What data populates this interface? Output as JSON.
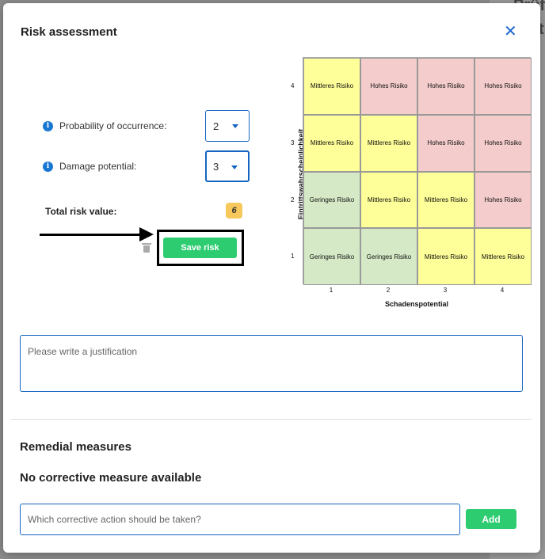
{
  "background": {
    "text_top": "Prüfu",
    "text_second": "t"
  },
  "modal": {
    "title": "Risk assessment",
    "close_label": "✕"
  },
  "form": {
    "probability_label": "Probability of occurrence:",
    "probability_value": "2",
    "damage_label": "Damage potential:",
    "damage_value": "3",
    "total_label": "Total risk value:",
    "total_value": "6",
    "save_label": "Save risk",
    "info_glyph": "i"
  },
  "matrix": {
    "ylabel": "Eintrittswahrscheinlichkeit",
    "xlabel": "Schadenspotential",
    "y_ticks": [
      "4",
      "3",
      "2",
      "1"
    ],
    "x_ticks": [
      "1",
      "2",
      "3",
      "4"
    ],
    "rows": [
      [
        {
          "text": "Mittleres Risiko",
          "level": "mid"
        },
        {
          "text": "Hohes Risiko",
          "level": "high"
        },
        {
          "text": "Hohes Risiko",
          "level": "high"
        },
        {
          "text": "Hohes Risiko",
          "level": "high"
        }
      ],
      [
        {
          "text": "Mittleres Risiko",
          "level": "mid"
        },
        {
          "text": "Mittleres Risiko",
          "level": "mid"
        },
        {
          "text": "Hohes Risiko",
          "level": "high"
        },
        {
          "text": "Hohes Risiko",
          "level": "high"
        }
      ],
      [
        {
          "text": "Geringes Risiko",
          "level": "low"
        },
        {
          "text": "Mittleres Risiko",
          "level": "mid"
        },
        {
          "text": "Mittleres Risiko",
          "level": "mid"
        },
        {
          "text": "Hohes Risiko",
          "level": "high"
        }
      ],
      [
        {
          "text": "Geringes Risiko",
          "level": "low"
        },
        {
          "text": "Geringes Risiko",
          "level": "low"
        },
        {
          "text": "Mittleres Risiko",
          "level": "mid"
        },
        {
          "text": "Mittleres Risiko",
          "level": "mid"
        }
      ]
    ],
    "colors": {
      "low": "#d6e9c6",
      "mid": "#ffff99",
      "high": "#f4cccc"
    }
  },
  "justification": {
    "placeholder": "Please write a justification"
  },
  "remedial": {
    "heading": "Remedial measures",
    "empty_message": "No corrective measure available",
    "input_placeholder": "Which corrective action should be taken?",
    "add_label": "Add"
  },
  "colors": {
    "accent": "#1565c0",
    "success": "#2ecc71",
    "badge": "#f7c95c"
  }
}
